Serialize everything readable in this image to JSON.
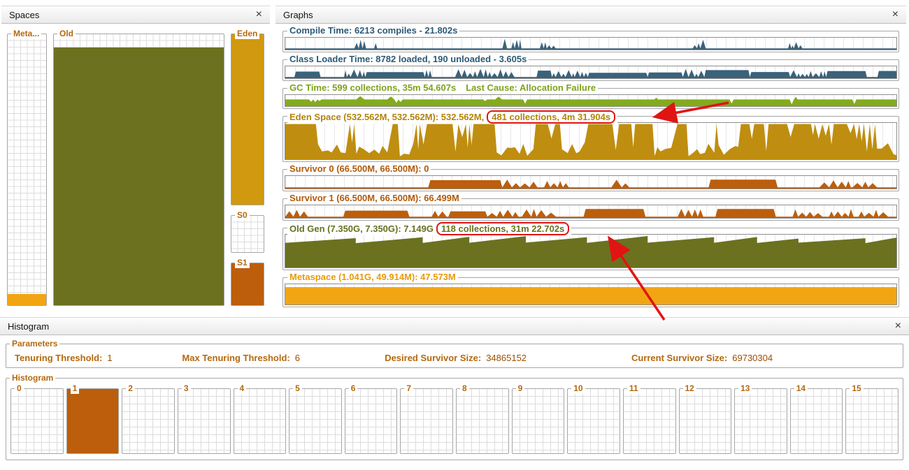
{
  "colors": {
    "legend_orange": "#b4690f",
    "annotation_red": "#e11414",
    "compile_slate": "#3a627b",
    "gc_green": "#84ab1d",
    "eden_gold": "#bf8e10",
    "survivor_orange": "#bc5e0c",
    "oldgen_olive": "#6c7120",
    "metaspace_orange": "#f2a513"
  },
  "spaces_panel": {
    "title": "Spaces",
    "close_label": "×",
    "regions": {
      "meta": {
        "label": "Meta...",
        "fill_percent": 4,
        "color": "#f2a513"
      },
      "old": {
        "label": "Old",
        "fill_percent": 95,
        "color": "#6c7120"
      },
      "eden": {
        "label": "Eden",
        "fill_percent": 100,
        "color": "#d0990f"
      },
      "s0": {
        "label": "S0",
        "fill_percent": 0,
        "color": "#bc5e0c"
      },
      "s1": {
        "label": "S1",
        "fill_percent": 100,
        "color": "#bc5e0c"
      }
    }
  },
  "graphs_panel": {
    "title": "Graphs",
    "close_label": "×",
    "graphs": [
      {
        "id": "compile-time",
        "title": "Compile Time: 6213 compiles - 21.802s",
        "suffix": "",
        "highlight": "",
        "color": "#3a627b",
        "text_color": "#2c5a75",
        "style": "spikes",
        "height": 17,
        "seed": 11
      },
      {
        "id": "classloader-time",
        "title": "Class Loader Time: 8782 loaded, 190 unloaded - 3.605s",
        "suffix": "",
        "highlight": "",
        "color": "#3a627b",
        "text_color": "#2c5a75",
        "style": "blocks",
        "height": 17,
        "seed": 23
      },
      {
        "id": "gc-time",
        "title": "GC Time: 599 collections, 35m 54.607s",
        "suffix": "Last Cause: Allocation Failure",
        "highlight": "",
        "color": "#84ab1d",
        "text_color": "#7da31c",
        "style": "band",
        "height": 16,
        "seed": 37
      },
      {
        "id": "eden-space",
        "title": "Eden Space (532.562M, 532.562M): 532.562M,",
        "suffix": "",
        "highlight": "481 collections, 4m 31.904s",
        "color": "#bf8e10",
        "text_color": "#b3830a",
        "style": "icicles",
        "height": 52,
        "seed": 41
      },
      {
        "id": "survivor-0",
        "title": "Survivor 0 (66.500M, 66.500M): 0",
        "suffix": "",
        "highlight": "",
        "color": "#bc5e0c",
        "text_color": "#b05a0a",
        "style": "survivor",
        "height": 18,
        "seed": 53
      },
      {
        "id": "survivor-1",
        "title": "Survivor 1 (66.500M, 66.500M): 66.499M",
        "suffix": "",
        "highlight": "",
        "color": "#bc5e0c",
        "text_color": "#b05a0a",
        "style": "survivor",
        "height": 18,
        "seed": 67
      },
      {
        "id": "old-gen",
        "title": "Old Gen (7.350G, 7.350G): 7.149G",
        "suffix": "",
        "highlight": "118 collections, 31m 22.702s",
        "color": "#6c7120",
        "text_color": "#68701f",
        "style": "sawtooth",
        "height": 47,
        "seed": 71
      },
      {
        "id": "metaspace",
        "title": "Metaspace (1.041G, 49.914M): 47.573M",
        "suffix": "",
        "highlight": "",
        "color": "#f2a513",
        "text_color": "#e89a08",
        "style": "flat",
        "height": 29,
        "seed": 83
      }
    ]
  },
  "histogram_panel": {
    "title": "Histogram",
    "close_label": "×",
    "parameters": {
      "legend": "Parameters",
      "items": [
        {
          "label": "Tenuring Threshold:",
          "value": "1"
        },
        {
          "label": "Max Tenuring Threshold:",
          "value": "6"
        },
        {
          "label": "Desired Survivor Size:",
          "value": "34865152"
        },
        {
          "label": "Current Survivor Size:",
          "value": "69730304"
        }
      ]
    },
    "histogram": {
      "legend": "Histogram",
      "fill_color": "#bc5e0c",
      "bins": [
        {
          "label": "0",
          "fill_percent": 0
        },
        {
          "label": "1",
          "fill_percent": 100
        },
        {
          "label": "2",
          "fill_percent": 0
        },
        {
          "label": "3",
          "fill_percent": 0
        },
        {
          "label": "4",
          "fill_percent": 0
        },
        {
          "label": "5",
          "fill_percent": 0
        },
        {
          "label": "6",
          "fill_percent": 0
        },
        {
          "label": "7",
          "fill_percent": 0
        },
        {
          "label": "8",
          "fill_percent": 0
        },
        {
          "label": "9",
          "fill_percent": 0
        },
        {
          "label": "10",
          "fill_percent": 0
        },
        {
          "label": "11",
          "fill_percent": 0
        },
        {
          "label": "12",
          "fill_percent": 0
        },
        {
          "label": "13",
          "fill_percent": 0
        },
        {
          "label": "14",
          "fill_percent": 0
        },
        {
          "label": "15",
          "fill_percent": 0
        }
      ]
    }
  }
}
